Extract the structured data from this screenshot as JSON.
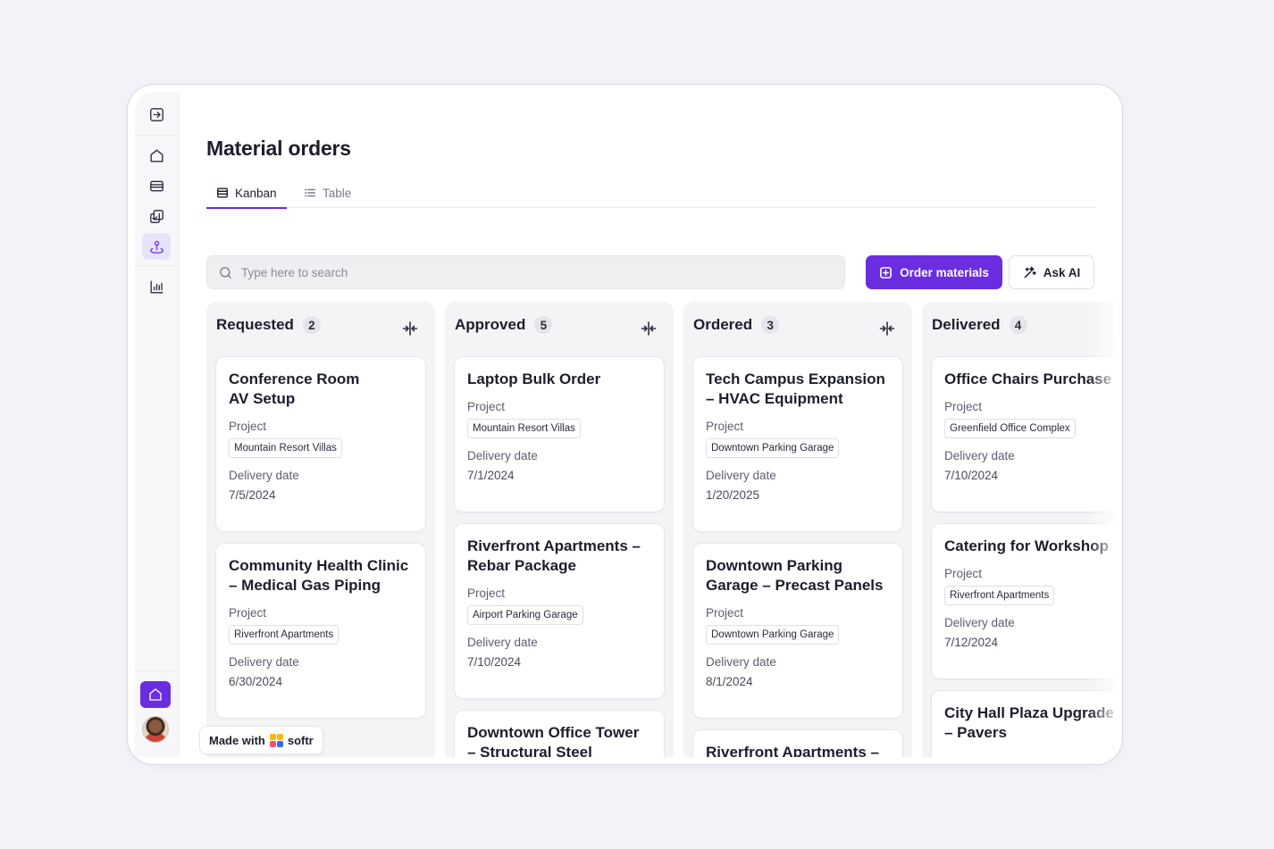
{
  "page": {
    "title": "Material orders"
  },
  "tabs": [
    {
      "label": "Kanban",
      "icon": "kanban-icon",
      "active": true
    },
    {
      "label": "Table",
      "icon": "list-icon",
      "active": false
    }
  ],
  "search": {
    "placeholder": "Type here to search",
    "value": ""
  },
  "actions": {
    "order_label": "Order materials",
    "ai_label": "Ask AI"
  },
  "colors": {
    "accent": "#6b2de0",
    "column_bg": "#f4f4f6"
  },
  "fields": {
    "project_label": "Project",
    "delivery_label": "Delivery date"
  },
  "columns": [
    {
      "title": "Requested",
      "count": "2",
      "cards": [
        {
          "title": "Conference Room\nAV Setup",
          "project": "Mountain Resort Villas",
          "delivery": "7/5/2024"
        },
        {
          "title": "Community Health Clinic\n– Medical Gas Piping",
          "project": "Riverfront Apartments",
          "delivery": "6/30/2024"
        }
      ]
    },
    {
      "title": "Approved",
      "count": "5",
      "cards": [
        {
          "title": "Laptop Bulk Order",
          "project": "Mountain Resort Villas",
          "delivery": "7/1/2024"
        },
        {
          "title": "Riverfront Apartments –\nRebar Package",
          "project": "Airport Parking Garage",
          "delivery": "7/10/2024"
        },
        {
          "title": "Downtown Office Tower\n– Structural Steel",
          "project": "",
          "delivery": ""
        }
      ]
    },
    {
      "title": "Ordered",
      "count": "3",
      "cards": [
        {
          "title": "Tech Campus Expansion\n– HVAC Equipment",
          "project": "Downtown Parking Garage",
          "delivery": "1/20/2025"
        },
        {
          "title": "Downtown Parking\nGarage – Precast Panels",
          "project": "Downtown Parking Garage",
          "delivery": "8/1/2024"
        },
        {
          "title": "Riverfront Apartments –",
          "project": "",
          "delivery": ""
        }
      ]
    },
    {
      "title": "Delivered",
      "count": "4",
      "cards": [
        {
          "title": "Office Chairs Purchase",
          "project": "Greenfield Office Complex",
          "delivery": "7/10/2024"
        },
        {
          "title": "Catering for Workshop",
          "project": "Riverfront Apartments",
          "delivery": "7/12/2024"
        },
        {
          "title": "City Hall Plaza Upgrade\n– Pavers",
          "project": "",
          "delivery": ""
        }
      ]
    }
  ],
  "badge": {
    "made_with": "Made with",
    "brand": "softr"
  }
}
